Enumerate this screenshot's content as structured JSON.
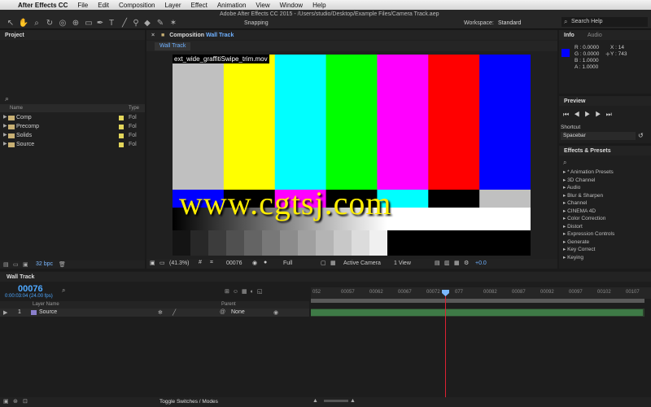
{
  "menubar": {
    "app_name": "After Effects CC",
    "items": [
      "File",
      "Edit",
      "Composition",
      "Layer",
      "Effect",
      "Animation",
      "View",
      "Window",
      "Help"
    ]
  },
  "toolbar": {
    "document_title": "Adobe After Effects CC 2015 - /Users/studio/Desktop/Example Files/Camera Track.aep",
    "snapping_label": "Snapping",
    "workspace_label": "Workspace:",
    "workspace_value": "Standard",
    "search_help": "Search Help"
  },
  "project": {
    "tab": "Project",
    "columns": {
      "name": "Name",
      "type": "Type"
    },
    "items": [
      {
        "name": "Comp",
        "type": "Fol"
      },
      {
        "name": "Precomp",
        "type": "Fol"
      },
      {
        "name": "Solids",
        "type": "Fol"
      },
      {
        "name": "Source",
        "type": "Fol"
      }
    ],
    "bpc": "32 bpc"
  },
  "composition": {
    "tab_prefix": "Composition",
    "tab_name": "Wall Track",
    "subtab": "Wall Track",
    "filename": "ext_wide_graffitiSwipe_trim.mov",
    "watermark": "www.cgtsj.com",
    "footer": {
      "zoom": "(41.3%)",
      "timecode": "00076",
      "resolution": "Full",
      "camera": "Active Camera",
      "views": "1 View",
      "exposure": "+0.0"
    },
    "bars_top": [
      "#c0c0c0",
      "#ffff00",
      "#00ffff",
      "#00ff00",
      "#ff00ff",
      "#ff0000",
      "#0000ff"
    ],
    "bars_mid": [
      "#0000ff",
      "#000000",
      "#ff00ff",
      "#000000",
      "#00ffff",
      "#000000",
      "#c0c0c0"
    ]
  },
  "info": {
    "tab": "Info",
    "tab2": "Audio",
    "r": "R : 0.0000",
    "g": "G : 0.0000",
    "b": "B : 1.0000",
    "a": "A : 1.0000",
    "x": "X : 14",
    "y": "Y : 743",
    "swatch_color": "#0000ff"
  },
  "preview": {
    "tab": "Preview",
    "shortcut_label": "Shortcut",
    "shortcut_value": "Spacebar"
  },
  "effects": {
    "tab": "Effects & Presets",
    "items": [
      "* Animation Presets",
      "3D Channel",
      "Audio",
      "Blur & Sharpen",
      "Channel",
      "CINEMA 4D",
      "Color Correction",
      "Distort",
      "Expression Controls",
      "Generate",
      "Key Correct",
      "Keying"
    ]
  },
  "timeline": {
    "tab": "Wall Track",
    "timecode": "00076",
    "timecode_sub": "0:00:03:04 (24.00 fps)",
    "columns": {
      "layer_name": "Layer Name",
      "parent": "Parent"
    },
    "layer": {
      "index": "1",
      "name": "Source",
      "parent": "None"
    },
    "ruler": [
      "052",
      "00057",
      "00062",
      "00067",
      "00072",
      "077",
      "00082",
      "00087",
      "00092",
      "00097",
      "00102",
      "00107"
    ],
    "toggle_label": "Toggle Switches / Modes"
  }
}
